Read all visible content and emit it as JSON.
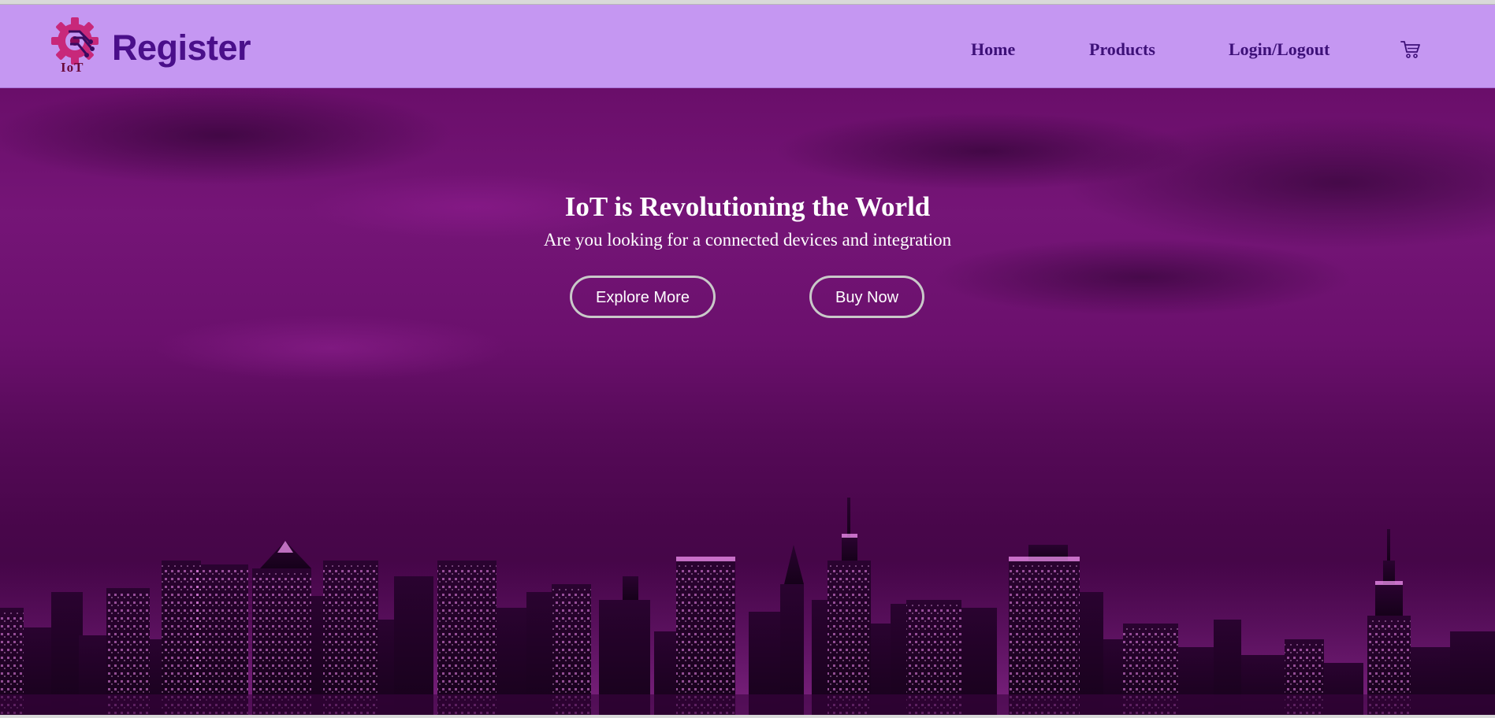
{
  "header": {
    "logo_text": "IoT",
    "brand": "Register",
    "nav": [
      {
        "label": "Home"
      },
      {
        "label": "Products"
      },
      {
        "label": "Login/Logout"
      }
    ],
    "cart_icon": "cart-icon"
  },
  "hero": {
    "title": "IoT is Revolutioning the World",
    "subtitle": "Are you looking for a connected devices and integration",
    "buttons": {
      "explore": "Explore More",
      "buy": "Buy Now"
    }
  },
  "colors": {
    "navbar_bg": "#c597f2",
    "brand": "#4a0f8a",
    "nav_link": "#3d1078",
    "hero_tint": "#6a0e6a",
    "button_border": "#c9c9c9"
  }
}
